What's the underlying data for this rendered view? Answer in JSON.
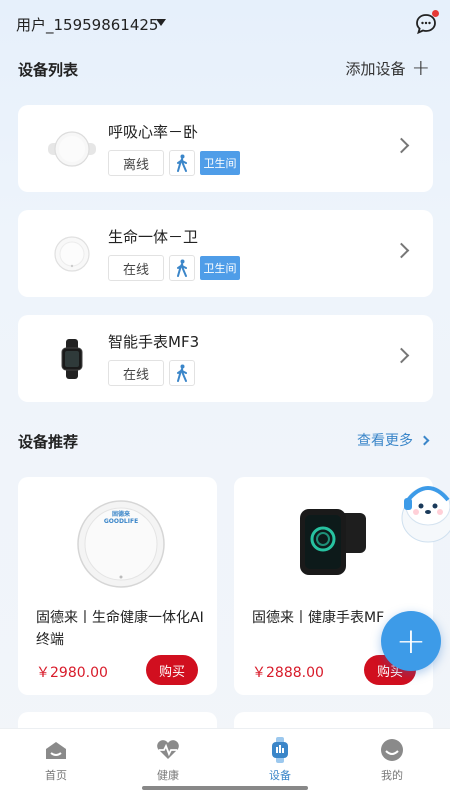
{
  "header": {
    "user": "用户_15959861425"
  },
  "device_list": {
    "title": "设备列表",
    "add_label": "添加设备",
    "devices": [
      {
        "name": "呼吸心率－卧",
        "status": "离线",
        "room": "卫生间",
        "icon": "round-sensor-icon"
      },
      {
        "name": "生命一体－卫",
        "status": "在线",
        "room": "卫生间",
        "icon": "ceiling-sensor-icon"
      },
      {
        "name": "智能手表MF3",
        "status": "在线",
        "room": "",
        "icon": "watch-icon"
      }
    ]
  },
  "recommend": {
    "title": "设备推荐",
    "more_label": "查看更多",
    "products": [
      {
        "title": "固德来丨生命健康一体化AI终端",
        "price": "￥2980.00",
        "buy_label": "购买",
        "logo_text": "固德来 GOODLIFE"
      },
      {
        "title": "固德来丨健康手表MF",
        "price": "￥2888.00",
        "buy_label": "购买"
      }
    ]
  },
  "tabs": [
    {
      "label": "首页",
      "icon": "home-icon"
    },
    {
      "label": "健康",
      "icon": "heartbeat-icon"
    },
    {
      "label": "设备",
      "icon": "watch-icon"
    },
    {
      "label": "我的",
      "icon": "profile-icon"
    }
  ],
  "colors": {
    "accent": "#3b86c9",
    "fab": "#3d9be8",
    "buy": "#d10f1f",
    "price": "#d81b2a",
    "room_tag": "#4f9de8"
  }
}
